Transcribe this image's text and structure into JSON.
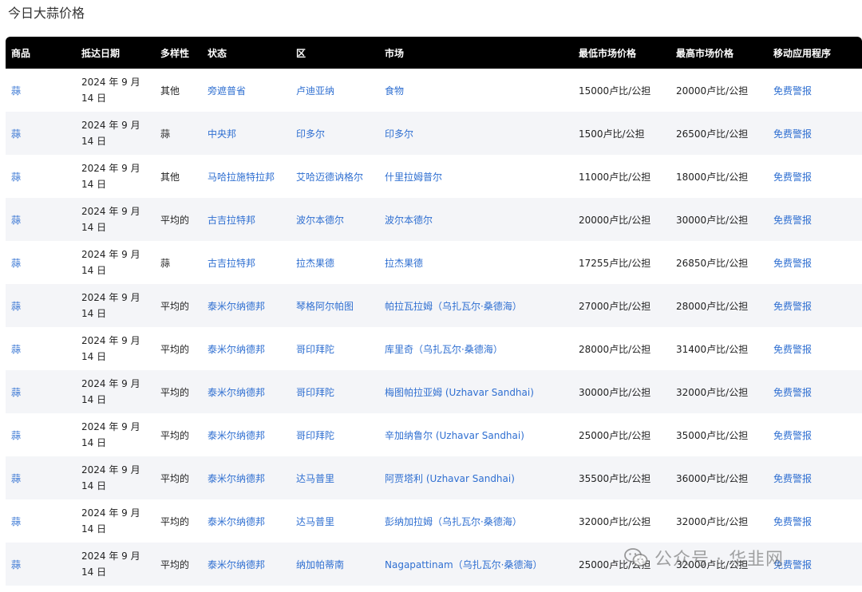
{
  "page": {
    "title": "今日大蒜价格"
  },
  "table": {
    "headers": [
      "商品",
      "抵达日期",
      "多样性",
      "状态",
      "区",
      "市场",
      "最低市场价格",
      "最高市场价格",
      "移动应用程序"
    ],
    "rows": [
      {
        "commodity": "蒜",
        "date": "2024 年 9 月 14 日",
        "variety": "其他",
        "state": "旁遮普省",
        "district": "卢迪亚纳",
        "market": "食物",
        "min_price": "15000卢比/公担",
        "max_price": "20000卢比/公担",
        "app": "免费警报"
      },
      {
        "commodity": "蒜",
        "date": "2024 年 9 月 14 日",
        "variety": "蒜",
        "state": "中央邦",
        "district": "印多尔",
        "market": "印多尔",
        "min_price": "1500卢比/公担",
        "max_price": "26500卢比/公担",
        "app": "免费警报"
      },
      {
        "commodity": "蒜",
        "date": "2024 年 9 月 14 日",
        "variety": "其他",
        "state": "马哈拉施特拉邦",
        "district": "艾哈迈德讷格尔",
        "market": "什里拉姆普尔",
        "min_price": "11000卢比/公担",
        "max_price": "18000卢比/公担",
        "app": "免费警报"
      },
      {
        "commodity": "蒜",
        "date": "2024 年 9 月 14 日",
        "variety": "平均的",
        "state": "古吉拉特邦",
        "district": "波尔本德尔",
        "market": "波尔本德尔",
        "min_price": "20000卢比/公担",
        "max_price": "30000卢比/公担",
        "app": "免费警报"
      },
      {
        "commodity": "蒜",
        "date": "2024 年 9 月 14 日",
        "variety": "蒜",
        "state": "古吉拉特邦",
        "district": "拉杰果德",
        "market": "拉杰果德",
        "min_price": "17255卢比/公担",
        "max_price": "26850卢比/公担",
        "app": "免费警报"
      },
      {
        "commodity": "蒜",
        "date": "2024 年 9 月 14 日",
        "variety": "平均的",
        "state": "泰米尔纳德邦",
        "district": "琴格阿尔帕图",
        "market": "帕拉瓦拉姆（乌扎瓦尔·桑德海）",
        "min_price": "27000卢比/公担",
        "max_price": "28000卢比/公担",
        "app": "免费警报"
      },
      {
        "commodity": "蒜",
        "date": "2024 年 9 月 14 日",
        "variety": "平均的",
        "state": "泰米尔纳德邦",
        "district": "哥印拜陀",
        "market": "库里奇（乌扎瓦尔·桑德海）",
        "min_price": "28000卢比/公担",
        "max_price": "31400卢比/公担",
        "app": "免费警报"
      },
      {
        "commodity": "蒜",
        "date": "2024 年 9 月 14 日",
        "variety": "平均的",
        "state": "泰米尔纳德邦",
        "district": "哥印拜陀",
        "market": "梅图帕拉亚姆 (Uzhavar Sandhai)",
        "min_price": "30000卢比/公担",
        "max_price": "32000卢比/公担",
        "app": "免费警报"
      },
      {
        "commodity": "蒜",
        "date": "2024 年 9 月 14 日",
        "variety": "平均的",
        "state": "泰米尔纳德邦",
        "district": "哥印拜陀",
        "market": "辛加纳鲁尔 (Uzhavar Sandhai)",
        "min_price": "25000卢比/公担",
        "max_price": "35000卢比/公担",
        "app": "免费警报"
      },
      {
        "commodity": "蒜",
        "date": "2024 年 9 月 14 日",
        "variety": "平均的",
        "state": "泰米尔纳德邦",
        "district": "达马普里",
        "market": "阿贾塔利 (Uzhavar Sandhai)",
        "min_price": "35500卢比/公担",
        "max_price": "36000卢比/公担",
        "app": "免费警报"
      },
      {
        "commodity": "蒜",
        "date": "2024 年 9 月 14 日",
        "variety": "平均的",
        "state": "泰米尔纳德邦",
        "district": "达马普里",
        "market": "彭纳加拉姆（乌扎瓦尔·桑德海）",
        "min_price": "32000卢比/公担",
        "max_price": "32000卢比/公担",
        "app": "免费警报"
      },
      {
        "commodity": "蒜",
        "date": "2024 年 9 月 14 日",
        "variety": "平均的",
        "state": "泰米尔纳德邦",
        "district": "纳加帕蒂南",
        "market": "Nagapattinam（乌扎瓦尔·桑德海）",
        "min_price": "25000卢比/公担",
        "max_price": "32000卢比/公担",
        "app": "免费警报"
      }
    ]
  },
  "watermark": {
    "text": "公众号 · 华韭网",
    "icon": "wechat-icon"
  },
  "colors": {
    "header_bg": "#000000",
    "link": "#2f6fd1",
    "stripe": "#f4f5f8"
  }
}
